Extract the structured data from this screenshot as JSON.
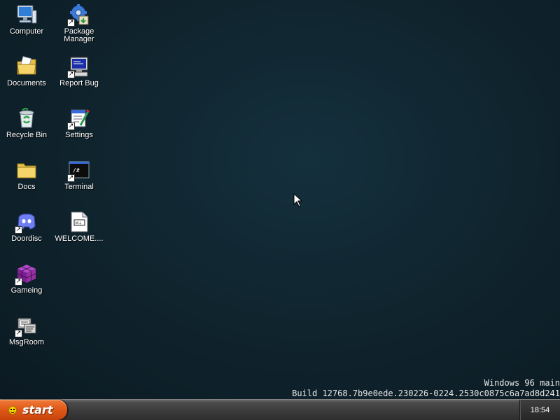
{
  "desktop": {
    "icons": [
      {
        "label": "Computer",
        "icon": "computer-icon",
        "shortcut": false
      },
      {
        "label": "Package Manager",
        "icon": "package-manager-icon",
        "shortcut": true
      },
      {
        "label": "Documents",
        "icon": "documents-folder-icon",
        "shortcut": false
      },
      {
        "label": "Report Bug",
        "icon": "report-bug-icon",
        "shortcut": true
      },
      {
        "label": "Recycle Bin",
        "icon": "recycle-bin-icon",
        "shortcut": false
      },
      {
        "label": "Settings",
        "icon": "settings-icon",
        "shortcut": true
      },
      {
        "label": "Docs",
        "icon": "folder-icon",
        "shortcut": false
      },
      {
        "label": "Terminal",
        "icon": "terminal-icon",
        "shortcut": true
      },
      {
        "label": "Doordisc",
        "icon": "doordisc-icon",
        "shortcut": true
      },
      {
        "label": "WELCOME....",
        "icon": "markdown-file-icon",
        "shortcut": false
      },
      {
        "label": "Gameing",
        "icon": "gameing-cube-icon",
        "shortcut": true
      },
      {
        "label": "MsgRoom",
        "icon": "msgroom-icon",
        "shortcut": true
      }
    ],
    "watermark": {
      "line1": "Windows 96 main",
      "line2": "Build 12768.7b9e0ede.230226-0224.2530c0875c6a7ad8d241"
    }
  },
  "taskbar": {
    "start_label": "start",
    "start_icon": "smiley-icon",
    "clock": "18:54"
  },
  "colors": {
    "desktop_background": "#10252f",
    "start_button": "#e05a18",
    "taskbar": "#3a3a3a"
  }
}
